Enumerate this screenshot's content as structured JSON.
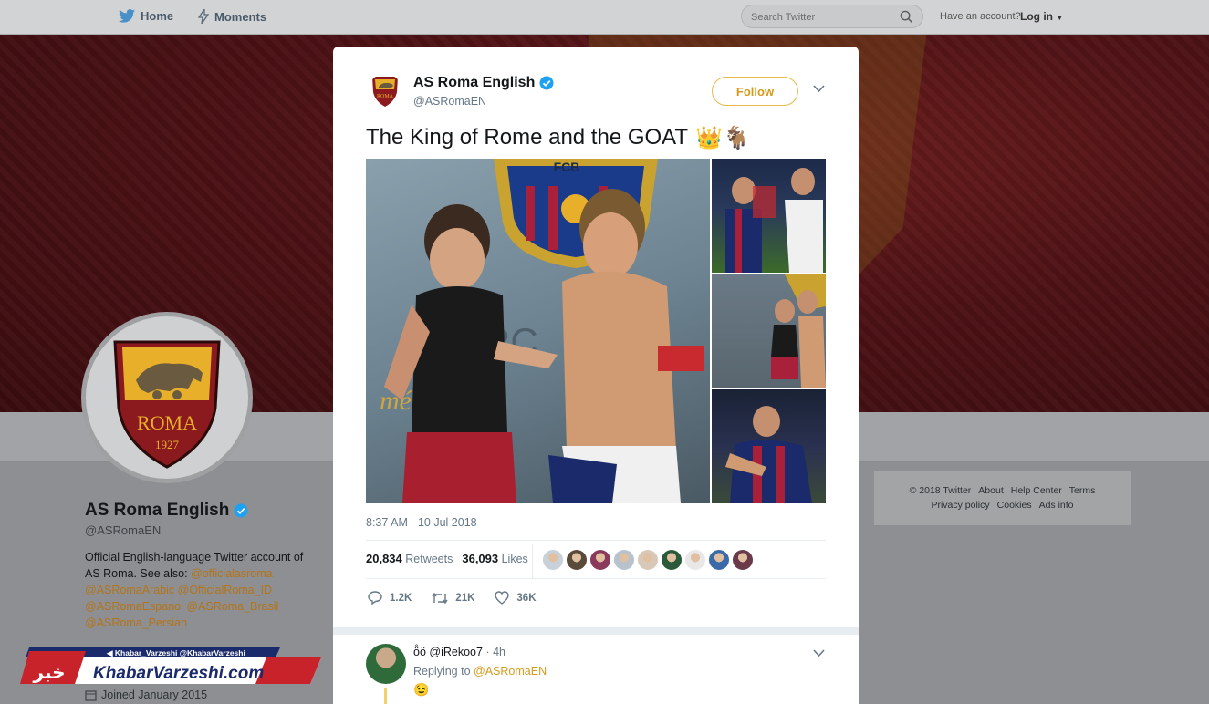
{
  "nav": {
    "home_label": "Home",
    "moments_label": "Moments",
    "search_placeholder": "Search Twitter",
    "have_account": "Have an account?",
    "login_label": "Log in"
  },
  "profile": {
    "name": "AS Roma English",
    "handle": "@ASRomaEN",
    "bio_text": "Official English-language Twitter account of AS Roma. See also: ",
    "bio_links": [
      "@officialasroma",
      "@ASRomaArabic",
      "@OfficialRoma_ID",
      "@ASRomaEspanol",
      "@ASRoma_Brasil",
      "@ASRoma_Persian"
    ],
    "joined": "Joined January 2015",
    "crest_text": "ROMA",
    "crest_year": "1927"
  },
  "footer": {
    "links": [
      "© 2018 Twitter",
      "About",
      "Help Center",
      "Terms",
      "Privacy policy",
      "Cookies",
      "Ads info"
    ]
  },
  "tweet": {
    "author_name": "AS Roma English",
    "author_handle": "@ASRomaEN",
    "follow_label": "Follow",
    "text": "The King of Rome and the GOAT",
    "emoji": "👑🐐",
    "time": "8:37 AM - 10 Jul 2018",
    "retweets_count": "20,834",
    "retweets_label": "Retweets",
    "likes_count": "36,093",
    "likes_label": "Likes",
    "reply_count": "1.2K",
    "retweet_action_count": "21K",
    "like_action_count": "36K",
    "photo_texts": {
      "fcb": "FCB",
      "sponsor": "ARC",
      "slogan": "més que un"
    },
    "liker_colors": [
      "#c8d0d8",
      "#5a4a3a",
      "#8a3a5a",
      "#b8c2cc",
      "#d8c8b8",
      "#2a5a3a",
      "#e8e8e8",
      "#3a6aa8",
      "#6a3a4a"
    ]
  },
  "reply": {
    "user_prefix": "ö̊ö",
    "username": "@iRekoo7",
    "time": "· 4h",
    "replying_to_label": "Replying to",
    "replying_to_handle": "@ASRomaEN",
    "emoji": "😉"
  },
  "watermark": {
    "top_line": "◀ Khabar_Varzeshi  @KhabarVarzeshi",
    "main": "KhabarVarzeshi.com",
    "badge": "خبر"
  },
  "colors": {
    "accent": "#d49a1a",
    "verified": "#1da1f2",
    "roma_red": "#8b1a1f",
    "roma_gold": "#e8b02a"
  }
}
